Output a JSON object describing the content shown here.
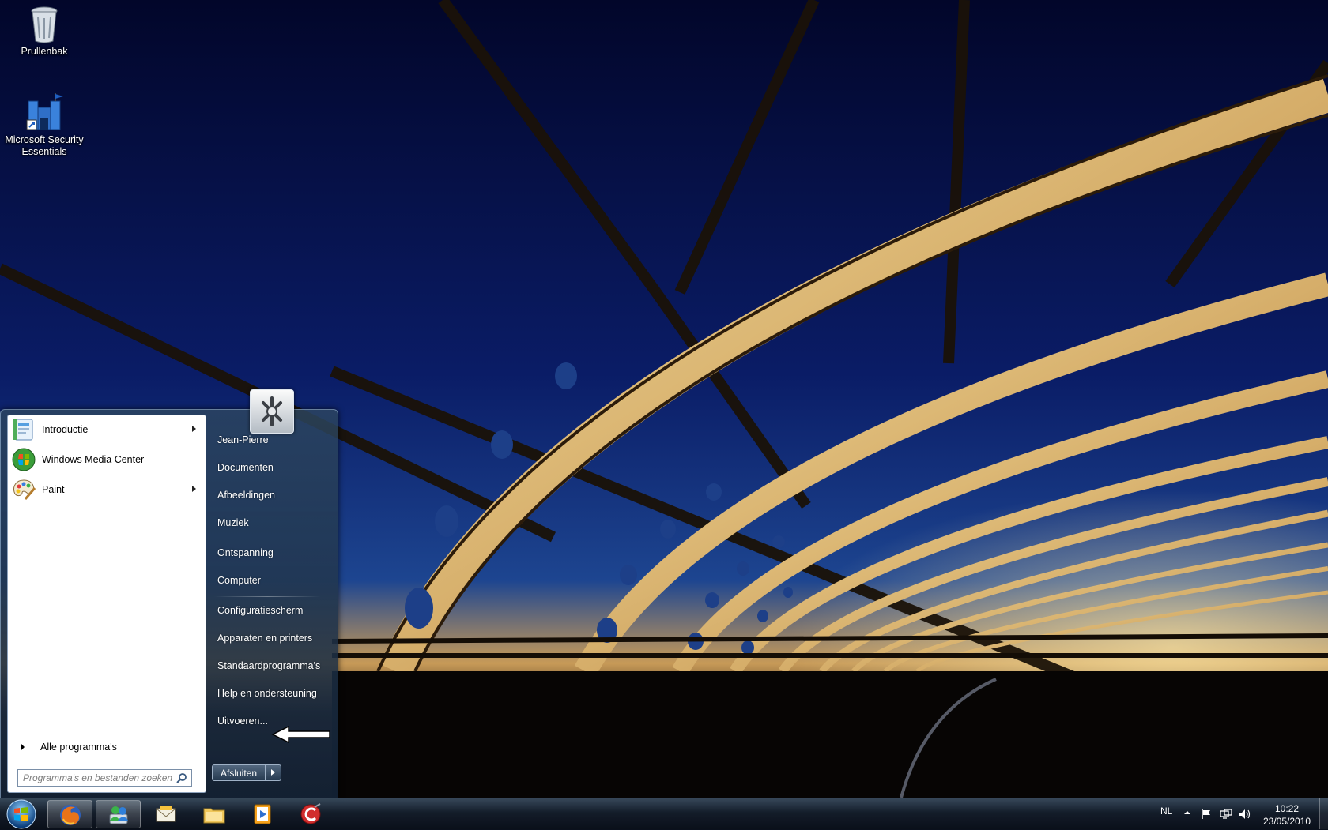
{
  "desktop": {
    "icons": [
      {
        "label": "Prullenbak",
        "icon": "recycle-bin-icon"
      },
      {
        "label": "Microsoft Security Essentials",
        "icon": "security-castle-icon"
      }
    ]
  },
  "start_menu": {
    "programs": [
      {
        "label": "Introductie",
        "icon": "getting-started-icon",
        "has_submenu": true
      },
      {
        "label": "Windows Media Center",
        "icon": "media-center-icon",
        "has_submenu": false
      },
      {
        "label": "Paint",
        "icon": "paint-palette-icon",
        "has_submenu": true
      }
    ],
    "all_programs_label": "Alle programma's",
    "search_placeholder": "Programma's en bestanden zoeken",
    "user_picture_icon": "user-tools-icon",
    "right_items": [
      "Jean-Pierre",
      "Documenten",
      "Afbeeldingen",
      "Muziek",
      "Ontspanning",
      "Computer",
      "Configuratiescherm",
      "Apparaten en printers",
      "Standaardprogramma's",
      "Help en ondersteuning",
      "Uitvoeren..."
    ],
    "shutdown_label": "Afsluiten"
  },
  "taskbar": {
    "pinned": [
      {
        "name": "firefox",
        "icon": "firefox-icon"
      },
      {
        "name": "windows-live-messenger",
        "icon": "messenger-icon"
      },
      {
        "name": "outlook-express",
        "icon": "mail-icon"
      },
      {
        "name": "windows-explorer",
        "icon": "folder-icon"
      },
      {
        "name": "media-player",
        "icon": "media-player-icon"
      },
      {
        "name": "ccleaner",
        "icon": "ccleaner-icon"
      }
    ],
    "language": "NL",
    "time": "10:22",
    "date": "23/05/2010"
  },
  "colors": {
    "sky_top": "#02072a",
    "sky_bottom": "#1a3f86",
    "bridge_gold": "#f3d58a",
    "taskbar": "#141e2d"
  }
}
